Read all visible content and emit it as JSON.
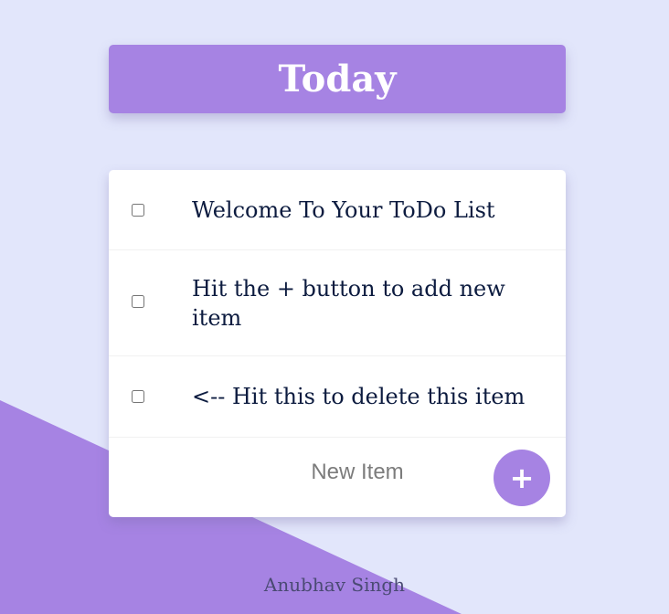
{
  "colors": {
    "accent": "#A683E3",
    "background": "#E2E6FB",
    "text": "#0C1B3F"
  },
  "heading": {
    "title": "Today"
  },
  "list": {
    "items": [
      {
        "text": "Welcome To Your ToDo List",
        "checked": false
      },
      {
        "text": "Hit the + button to add new item",
        "checked": false
      },
      {
        "text": "<-- Hit this to delete this item",
        "checked": false
      }
    ]
  },
  "new_item": {
    "placeholder": "New Item",
    "value": "",
    "add_label": "+"
  },
  "footer": {
    "text": "Anubhav Singh"
  }
}
